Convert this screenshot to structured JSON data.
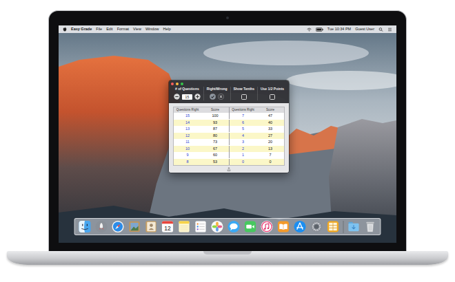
{
  "menu_bar": {
    "app_name": "Easy Grade",
    "menus": [
      "File",
      "Edit",
      "Format",
      "View",
      "Window",
      "Help"
    ],
    "clock": "Tue 10:34 PM",
    "user": "Guest User"
  },
  "window": {
    "questions": {
      "label": "# of Questions",
      "value": "15"
    },
    "right_wrong": {
      "label": "Right/Wrong",
      "buttons": [
        {
          "kind": "check",
          "selected": true
        },
        {
          "kind": "cross",
          "selected": false
        }
      ]
    },
    "show_tenths": {
      "label": "Show Tenths",
      "checked": false
    },
    "half_points": {
      "label": "Use 1/2 Points",
      "checked": false
    },
    "table": {
      "columns": [
        "Questions Right",
        "Score",
        "Questions Right",
        "Score"
      ],
      "rows": [
        {
          "cells": [
            "15",
            "100",
            "7",
            "47"
          ]
        },
        {
          "cells": [
            "14",
            "93",
            "6",
            "40"
          ]
        },
        {
          "cells": [
            "13",
            "87",
            "5",
            "33"
          ]
        },
        {
          "cells": [
            "12",
            "80",
            "4",
            "27"
          ]
        },
        {
          "cells": [
            "11",
            "73",
            "3",
            "20"
          ]
        },
        {
          "cells": [
            "10",
            "67",
            "2",
            "13"
          ]
        },
        {
          "cells": [
            "9",
            "60",
            "1",
            "7"
          ]
        },
        {
          "cells": [
            "8",
            "53",
            "0",
            "0"
          ]
        }
      ]
    }
  },
  "dock": {
    "apps": [
      {
        "kind": "finder"
      },
      {
        "kind": "launchpad"
      },
      {
        "kind": "safari"
      },
      {
        "kind": "preview"
      },
      {
        "kind": "contacts"
      },
      {
        "kind": "calendar",
        "label": "12"
      },
      {
        "kind": "notes"
      },
      {
        "kind": "reminders"
      },
      {
        "kind": "photos"
      },
      {
        "kind": "messages"
      },
      {
        "kind": "facetime"
      },
      {
        "kind": "itunes"
      },
      {
        "kind": "ibooks"
      },
      {
        "kind": "app-store"
      },
      {
        "kind": "preferences"
      },
      {
        "kind": "easy-grade"
      }
    ],
    "stacks": [
      {
        "kind": "downloads"
      },
      {
        "kind": "trash"
      }
    ]
  }
}
